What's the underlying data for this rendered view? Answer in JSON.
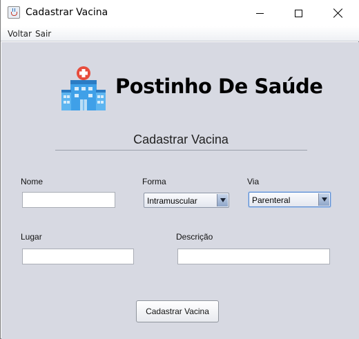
{
  "window": {
    "title": "Cadastrar Vacina"
  },
  "menu": {
    "items": [
      {
        "label": "Voltar"
      },
      {
        "label": "Sair"
      }
    ]
  },
  "header": {
    "brand": "Postinho De Saúde",
    "logo_icon": "hospital-icon"
  },
  "form": {
    "title": "Cadastrar Vacina",
    "fields": {
      "nome": {
        "label": "Nome",
        "value": ""
      },
      "forma": {
        "label": "Forma",
        "value": "Intramuscular"
      },
      "via": {
        "label": "Via",
        "value": "Parenteral"
      },
      "lugar": {
        "label": "Lugar",
        "value": ""
      },
      "descricao": {
        "label": "Descrição",
        "value": ""
      }
    },
    "submit_label": "Cadastrar Vacina"
  },
  "colors": {
    "panel_bg": "#d7d9e2",
    "logo_red": "#e74c3c",
    "logo_blue": "#2e86de"
  }
}
